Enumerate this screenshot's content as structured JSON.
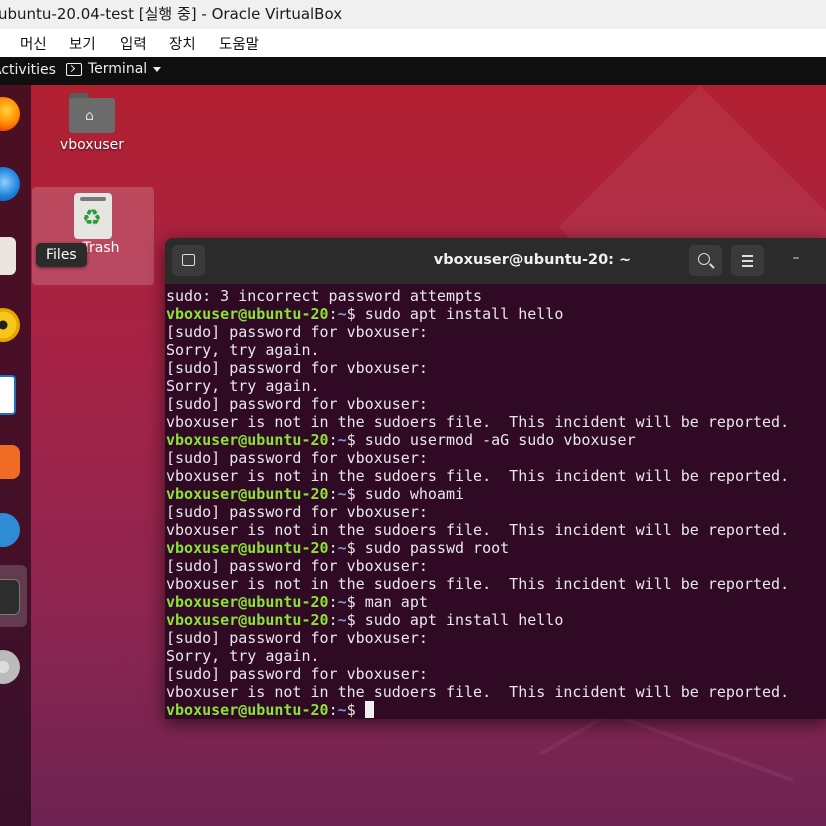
{
  "window": {
    "title": "ubuntu-20.04-test [실행 중] - Oracle VirtualBox"
  },
  "menubar": [
    "머신",
    "보기",
    "입력",
    "장치",
    "도움말"
  ],
  "topbar": {
    "activities": "Activities",
    "app_name": "Terminal"
  },
  "desktop": {
    "home_label": "vboxuser",
    "trash_label": "Trash",
    "tooltip": "Files"
  },
  "terminal": {
    "title": "vboxuser@ubuntu-20: ~",
    "lines": [
      {
        "text": "sudo: 3 incorrect password attempts"
      },
      {
        "prompt": "vboxuser@ubuntu-20",
        "path": "~",
        "cmd": "sudo apt install hello"
      },
      {
        "text": "[sudo] password for vboxuser:"
      },
      {
        "text": "Sorry, try again."
      },
      {
        "text": "[sudo] password for vboxuser:"
      },
      {
        "text": "Sorry, try again."
      },
      {
        "text": "[sudo] password for vboxuser:"
      },
      {
        "text": "vboxuser is not in the sudoers file.  This incident will be reported."
      },
      {
        "prompt": "vboxuser@ubuntu-20",
        "path": "~",
        "cmd": "sudo usermod -aG sudo vboxuser"
      },
      {
        "text": "[sudo] password for vboxuser:"
      },
      {
        "text": "vboxuser is not in the sudoers file.  This incident will be reported."
      },
      {
        "prompt": "vboxuser@ubuntu-20",
        "path": "~",
        "cmd": "sudo whoami"
      },
      {
        "text": "[sudo] password for vboxuser:"
      },
      {
        "text": "vboxuser is not in the sudoers file.  This incident will be reported."
      },
      {
        "prompt": "vboxuser@ubuntu-20",
        "path": "~",
        "cmd": "sudo passwd root"
      },
      {
        "text": "[sudo] password for vboxuser:"
      },
      {
        "text": "vboxuser is not in the sudoers file.  This incident will be reported."
      },
      {
        "prompt": "vboxuser@ubuntu-20",
        "path": "~",
        "cmd": "man apt"
      },
      {
        "prompt": "vboxuser@ubuntu-20",
        "path": "~",
        "cmd": "sudo apt install hello"
      },
      {
        "text": "[sudo] password for vboxuser:"
      },
      {
        "text": "Sorry, try again."
      },
      {
        "text": "[sudo] password for vboxuser:"
      },
      {
        "text": "vboxuser is not in the sudoers file.  This incident will be reported."
      },
      {
        "prompt": "vboxuser@ubuntu-20",
        "path": "~",
        "cmd": "",
        "cursor": true
      }
    ]
  },
  "colors": {
    "prompt_user": "#8ae234",
    "prompt_path": "#729fcf",
    "terminal_bg": "#300a24"
  },
  "icons": [
    "home-folder-icon",
    "trash-icon",
    "new-tab-icon",
    "search-icon",
    "hamburger-menu-icon",
    "minimize-icon",
    "firefox-icon",
    "thunderbird-icon",
    "files-icon",
    "rhythmbox-icon",
    "writer-icon",
    "software-icon",
    "help-icon",
    "terminal-icon",
    "dvd-icon"
  ]
}
